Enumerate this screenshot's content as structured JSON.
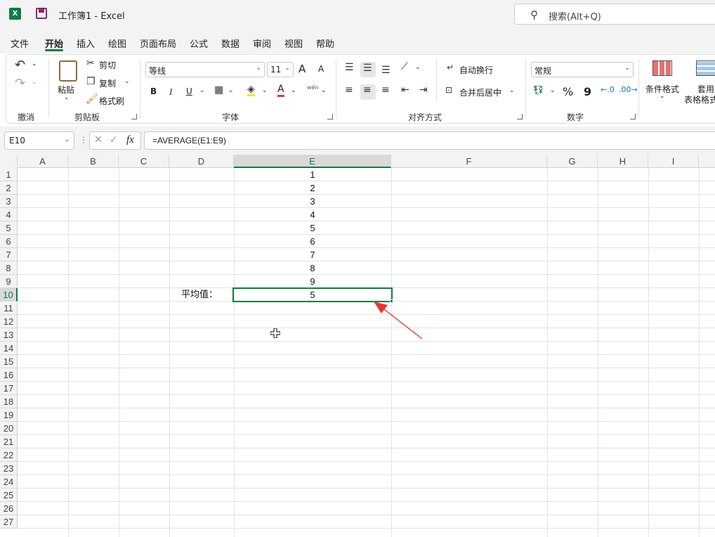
{
  "titlebar": {
    "app_logo": "X",
    "title": "工作簿1  -  Excel",
    "search_placeholder": "搜索(Alt+Q)"
  },
  "menu": [
    "文件",
    "开始",
    "插入",
    "绘图",
    "页面布局",
    "公式",
    "数据",
    "审阅",
    "视图",
    "帮助"
  ],
  "ribbon": {
    "undo_group": "撤消",
    "clipboard": {
      "paste": "粘贴",
      "cut": "剪切",
      "copy": "复制",
      "format_painter": "格式刷",
      "label": "剪贴板"
    },
    "font": {
      "name": "等线",
      "size": "11",
      "bold": "B",
      "italic": "I",
      "underline": "U",
      "grow": "A",
      "shrink": "A",
      "font_color": "A",
      "phonetic": "wén",
      "label": "字体"
    },
    "alignment": {
      "wrap": "自动换行",
      "merge": "合并后居中",
      "label": "对齐方式"
    },
    "number": {
      "format": "常规",
      "percent": "%",
      "comma": "9",
      "label": "数字"
    },
    "styles": {
      "conditional": "条件格式",
      "table_line1": "套用",
      "table_line2": "表格格式"
    }
  },
  "formula_bar": {
    "name_box": "E10",
    "fx": "fx",
    "formula": "=AVERAGE(E1:E9)"
  },
  "columns": [
    "A",
    "B",
    "C",
    "D",
    "E",
    "F",
    "G",
    "H",
    "I"
  ],
  "rows": [
    "1",
    "2",
    "3",
    "4",
    "5",
    "6",
    "7",
    "8",
    "9",
    "10",
    "11",
    "12",
    "13",
    "14",
    "15",
    "16",
    "17",
    "18",
    "19",
    "20",
    "21",
    "22",
    "23",
    "24",
    "25",
    "26",
    "27"
  ],
  "cells": {
    "e_values": [
      "1",
      "2",
      "3",
      "4",
      "5",
      "6",
      "7",
      "8",
      "9",
      "5"
    ],
    "d10": "平均值："
  },
  "accent_color": "#107c41",
  "arrow_color": "#e53935"
}
